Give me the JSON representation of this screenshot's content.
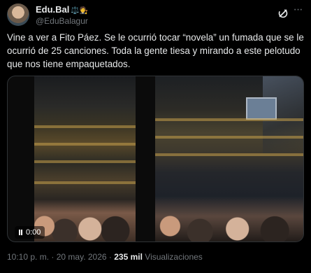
{
  "author": {
    "name": "Edu.Bal",
    "badge": "⚖️🧑‍⚖️",
    "handle": "@EduBalagur"
  },
  "tweet": {
    "text": "Vine a ver a Fito Páez. Se le ocurrió tocar “novela” un fumada que se le ocurrió de 25 canciones. Toda la gente tiesa y mirando a este pelotudo que nos tiene empaquetados."
  },
  "video": {
    "time": "0:00"
  },
  "meta": {
    "time": "10:10 p. m.",
    "separator": "·",
    "date": "20 may. 2026",
    "views_count": "235 mil",
    "views_label": "Visualizaciones"
  },
  "colors": {
    "background": "#000000",
    "text": "#e7e9ea",
    "secondary": "#71767b"
  }
}
